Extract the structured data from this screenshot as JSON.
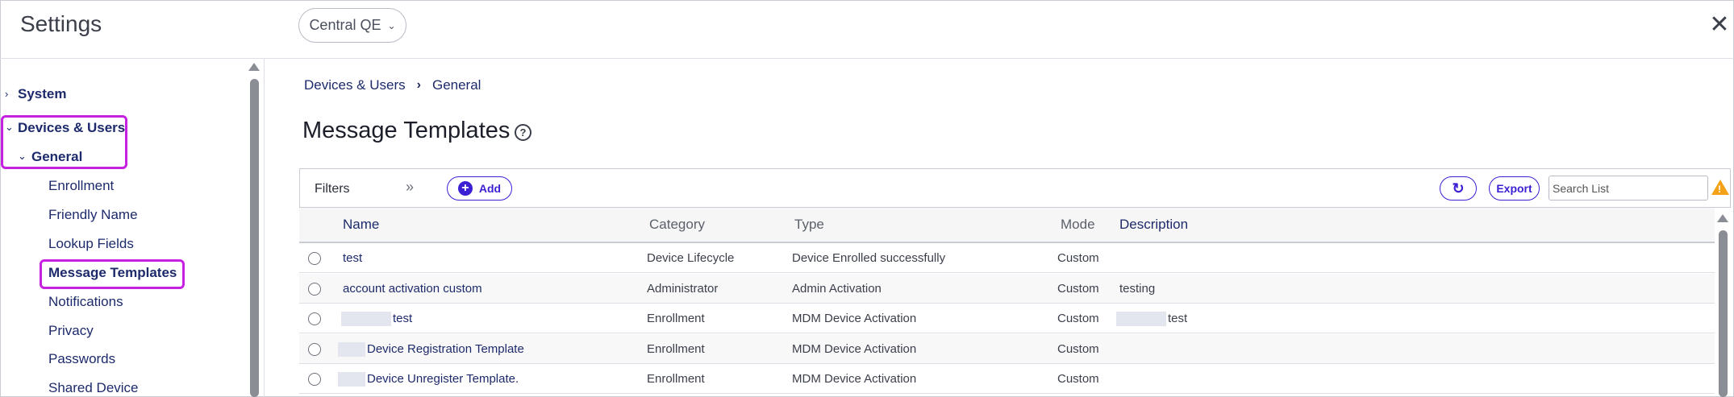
{
  "header": {
    "title": "Settings",
    "tenant": "Central QE"
  },
  "sidebar": {
    "items": [
      {
        "label": "System"
      },
      {
        "label": "Devices & Users"
      },
      {
        "label": "General"
      },
      {
        "label": "Enrollment"
      },
      {
        "label": "Friendly Name"
      },
      {
        "label": "Lookup Fields"
      },
      {
        "label": "Message Templates"
      },
      {
        "label": "Notifications"
      },
      {
        "label": "Privacy"
      },
      {
        "label": "Passwords"
      },
      {
        "label": "Shared Device"
      }
    ]
  },
  "breadcrumb": {
    "items": [
      "Devices & Users",
      "General"
    ]
  },
  "page": {
    "title": "Message Templates"
  },
  "toolbar": {
    "filters_label": "Filters",
    "add_label": "Add",
    "export_label": "Export",
    "search_placeholder": "Search List"
  },
  "table": {
    "columns": [
      "Name",
      "Category",
      "Type",
      "Mode",
      "Description"
    ],
    "rows": [
      {
        "name": "test",
        "category": "Device Lifecycle",
        "type": "Device Enrolled successfully",
        "mode": "Custom",
        "description": ""
      },
      {
        "name": "account activation custom",
        "category": "Administrator",
        "type": "Admin Activation",
        "mode": "Custom",
        "description": "testing"
      },
      {
        "name": "test",
        "category": "Enrollment",
        "type": "MDM Device Activation",
        "mode": "Custom",
        "description": "test"
      },
      {
        "name": "Device Registration Template",
        "category": "Enrollment",
        "type": "MDM Device Activation",
        "mode": "Custom",
        "description": ""
      },
      {
        "name": "Device Unregister Template.",
        "category": "Enrollment",
        "type": "MDM Device Activation",
        "mode": "Custom",
        "description": ""
      }
    ]
  },
  "colors": {
    "accent": "#3a1fd4",
    "highlight": "#c620e0",
    "warning": "#f3a21a",
    "nav_text": "#1d2a6b"
  }
}
